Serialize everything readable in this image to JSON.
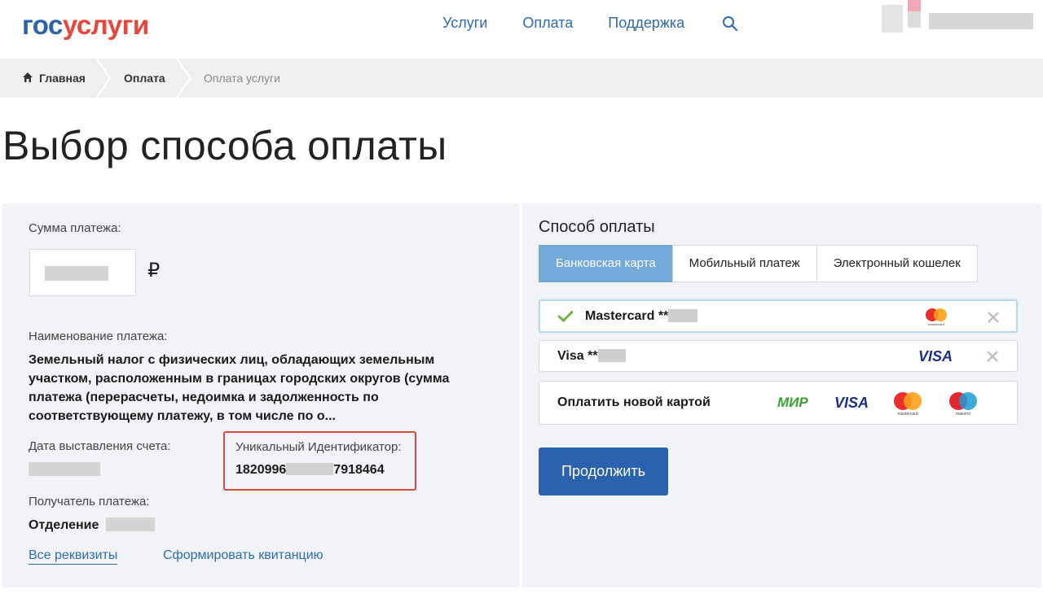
{
  "header": {
    "logo_part1": "гос",
    "logo_part2": "услуги",
    "nav": [
      "Услуги",
      "Оплата",
      "Поддержка"
    ],
    "search_icon": "search-icon"
  },
  "breadcrumbs": {
    "home": "Главная",
    "payment": "Оплата",
    "current": "Оплата услуги"
  },
  "page_title": "Выбор способа оплаты",
  "payment_info": {
    "amount_label": "Сумма платежа:",
    "currency_symbol": "₽",
    "name_label": "Наименование платежа:",
    "name_value": "Земельный налог с физических лиц, обладающих земельным участком, расположенным в границах городских округов (сумма платежа (перерасчеты, недоимка и задолженность по соответствующему платежу, в том числе по о...",
    "invoice_date_label": "Дата выставления счета:",
    "uid_label": "Уникальный Идентификатор:",
    "uid_prefix": "1820996",
    "uid_suffix": "7918464",
    "recipient_label": "Получатель платежа:",
    "recipient_value": "Отделение",
    "link_details": "Все реквизиты",
    "link_receipt": "Сформировать квитанцию"
  },
  "payment_method": {
    "title": "Способ оплаты",
    "tabs": [
      "Банковская карта",
      "Мобильный платеж",
      "Электронный кошелек"
    ],
    "active_tab": 0,
    "saved_cards": [
      {
        "name": "Mastercard **",
        "brand": "mastercard-logo",
        "brand_caption": "mastercard",
        "selected": true
      },
      {
        "name": "Visa **",
        "brand": "visa-logo",
        "brand_caption": "VISA",
        "selected": false
      }
    ],
    "new_card_label": "Оплатить новой картой",
    "new_card_brands": [
      "МИР",
      "VISA",
      "mastercard",
      "maestro"
    ],
    "continue_button": "Продолжить"
  },
  "colors": {
    "brand_blue": "#2a63a9",
    "brand_red": "#e8463a",
    "active_tab": "#73a9d9",
    "button": "#2b62ae",
    "highlight": "#d84a3e",
    "mir_green": "#3aa335"
  }
}
